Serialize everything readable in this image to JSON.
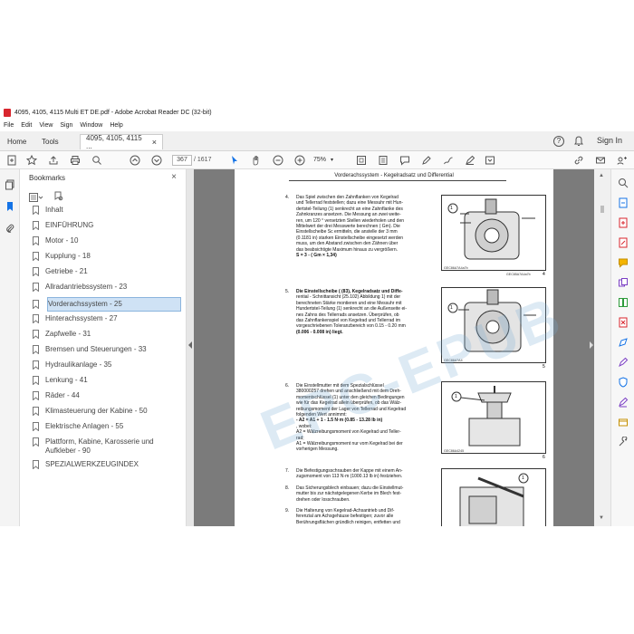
{
  "window": {
    "title": "4095, 4105, 4115 Multi ET DE.pdf - Adobe Acrobat Reader DC (32-bit)"
  },
  "menu": [
    "File",
    "Edit",
    "View",
    "Sign",
    "Window",
    "Help"
  ],
  "tabs": {
    "home": "Home",
    "tools": "Tools",
    "doc": "4095, 4105, 4115 ...",
    "close": "×"
  },
  "header_right": {
    "sign_in": "Sign In"
  },
  "toolbar": {
    "page_current": "367",
    "page_total": "/ 1617",
    "zoom": "75%"
  },
  "bookmarks": {
    "title": "Bookmarks",
    "items": [
      "Inhalt",
      "EINFÜHRUNG",
      "Motor - 10",
      "Kupplung - 18",
      "Getriebe - 21",
      "Allradantriebssystem - 23",
      "Vorderachssystem - 25",
      "Hinterachssystem - 27",
      "Zapfwelle - 31",
      "Bremsen und Steuerungen - 33",
      "Hydraulikanlage - 35",
      "Lenkung - 41",
      "Räder - 44",
      "Klimasteuerung der Kabine - 50",
      "Elektrische Anlagen - 55",
      "Plattform, Kabine, Karosserie und Aufkleber - 90",
      "SPEZIALWERKZEUGINDEX"
    ],
    "selected_index": 6
  },
  "document": {
    "header": "Vorderachssystem - Kegelradsatz und Differential",
    "steps": [
      {
        "num": "4.",
        "lines": [
          "Das Spiel zwischen den Zahnflanken von Kegelrad",
          "und Tellerrad feststellen; dazu eine Messuhr mit Hun-",
          "dertstel-Teilung (1) senkrecht an eine Zahnflanke des",
          "Zahnkranzes ansetzen. Die Messung an zwei weite-",
          "ren, um 120 ° versetzten Stellen wiederholen und den",
          "Mittelwert der drei Messwerte berechnen ( Gm). Die",
          "Einstellscheibe Sc ermitteln, die anstelle der 3 mm",
          "(0.1181 in) starken Einstellscheibe eingesetzt werden",
          "muss, um den Abstand zwischen den Zähnen über",
          "das beabsichtigte Maximum hinaus zu vergrößern.",
          "S = 3 - ( Gm × 1,34)"
        ]
      },
      {
        "num": "5.",
        "lines": [
          "Die Einstellscheibe ( (83), Kegelradsatz und Diffe-",
          "rential - Schnittansicht (25.102) Abbildung 1) mit der",
          "berechneten Stärke montieren und eine Messuhr mit",
          "Hundertstel-Teilung (1) senkrecht an die Außenseite ei-",
          "nes Zahns des Tellerrads ansetzen. Überprüfen, ob",
          "das Zahnflankenspiel von Kegelrad und Tellerrad im",
          "vorgeschriebenen Toleranzbereich von 0.15 - 0.20 mm",
          "(0.006 - 0.008 in) liegt."
        ]
      },
      {
        "num": "6.",
        "lines": [
          "Die Einstellmutter mit dem Spezialschlüssel",
          "380000257 drehen und anschließend mit dem Dreh-",
          "momentschlüssel (1) unter den gleichen Bedingungen",
          "wie für das Kegelrad allein überprüfen, ob das Wälz-",
          "reibungsmoment der Lager von Tellerrad und Kegelrad",
          "folgenden Wert annimmt:",
          "- A2 = A1 + 1 - 1.5 N·m (0.85 - 13.28 lb in)",
          ", wobei:",
          "A2 = Wälzreibungsmoment von Kegelrad und Teller-",
          "rad;",
          "A1 = Wälzreibungsmoment nur vom Kegelrad bei der",
          "vorherigen Messung."
        ]
      },
      {
        "num": "7.",
        "lines": [
          "Die Befestigungsschrauben der Kappe mit einem An-",
          "zugsmoment von 113 N·m (1000.13 lb in) festziehen."
        ]
      },
      {
        "num": "8.",
        "lines": [
          "Das Sicherungsblech einbauen; dazu die Einstellmut-",
          "mutter bis zur nächstgelegenen Kerbe im Blech fest-",
          "drehen oder losschrauben."
        ]
      },
      {
        "num": "9.",
        "lines": [
          "Die Halterung von Kegelrad-Achsantrieb und Dif-",
          "ferenzial am Achsgehäuse befestigen; zuvor alle",
          "Berührungsflächen gründlich reinigen, entfetten und"
        ]
      }
    ],
    "figures": [
      {
        "caption_left": "GEC86A7A4a7b",
        "caption_right": "GEC85A7A4a7b",
        "num": "4",
        "callout": "1"
      },
      {
        "caption_left": "GEC86A7A4",
        "caption_right": "",
        "num": "5",
        "callout": "1"
      },
      {
        "caption_left": "GEC86A4245",
        "caption_right": "",
        "num": "6",
        "callout": "1"
      },
      {
        "caption_left": "",
        "caption_right": "",
        "num": "7",
        "callout": "1"
      }
    ],
    "watermark": "EPC-EPUB"
  },
  "colors": {
    "selection": "#cfe2f5",
    "pdf_red": "#d8262e",
    "accent_blue": "#1473e6"
  }
}
